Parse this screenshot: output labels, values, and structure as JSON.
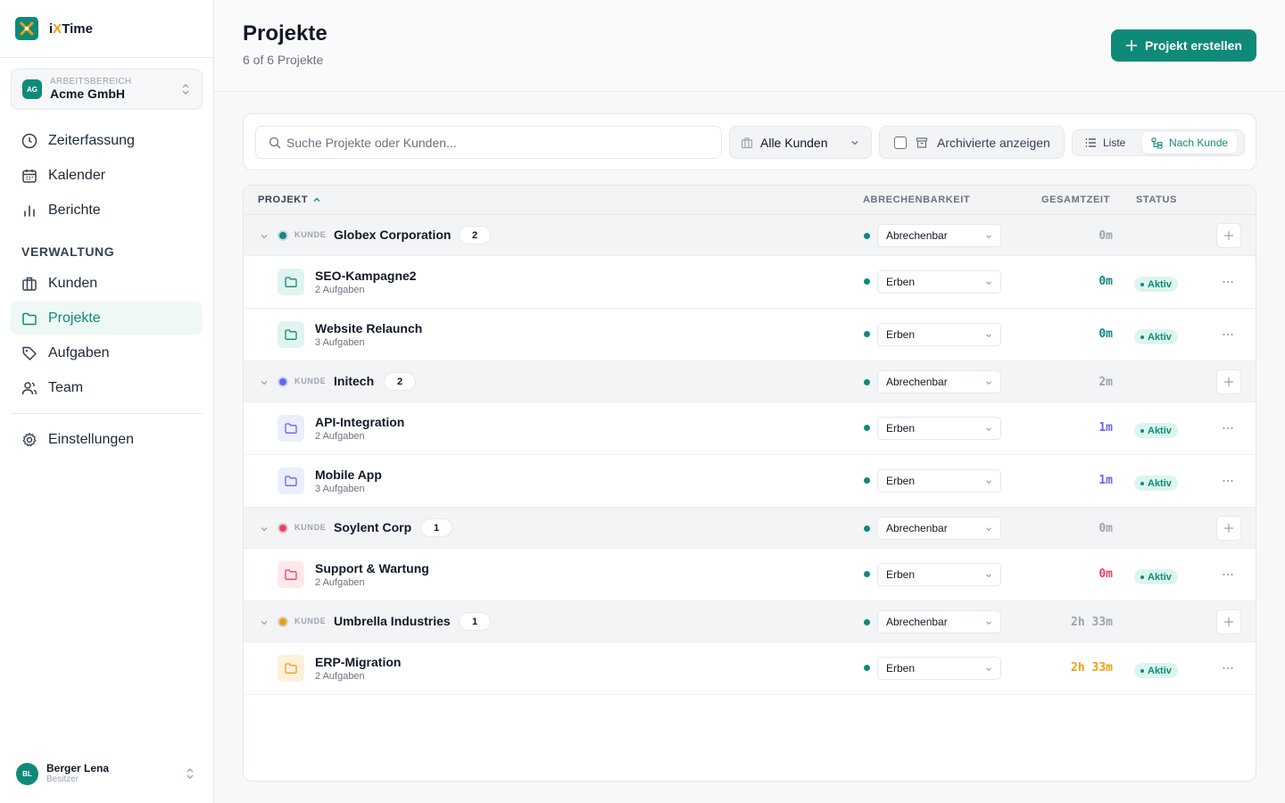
{
  "app": {
    "name_prefix": "i",
    "name_x": "X",
    "name_suffix": "Time"
  },
  "workspace": {
    "label": "ARBEITSBEREICH",
    "name": "Acme GmbH",
    "initials": "AG"
  },
  "nav": {
    "zeiterfassung": "Zeiterfassung",
    "kalender": "Kalender",
    "berichte": "Berichte",
    "section": "VERWALTUNG",
    "kunden": "Kunden",
    "projekte": "Projekte",
    "aufgaben": "Aufgaben",
    "team": "Team",
    "einstellungen": "Einstellungen"
  },
  "user": {
    "initials": "BL",
    "name": "Berger Lena",
    "role": "Besitzer"
  },
  "header": {
    "title": "Projekte",
    "subtitle": "6 of 6 Projekte",
    "create_label": "Projekt erstellen"
  },
  "toolbar": {
    "search_placeholder": "Suche Projekte oder Kunden...",
    "customer_filter": "Alle Kunden",
    "archive_label": "Archivierte anzeigen",
    "view_list": "Liste",
    "view_by_customer": "Nach Kunde"
  },
  "table": {
    "headers": {
      "project": "PROJEKT",
      "billing": "ABRECHENBARKEIT",
      "total": "GESAMTZEIT",
      "status": "STATUS"
    },
    "kunde_label": "KUNDE",
    "groups": [
      {
        "name": "Globex Corporation",
        "count": "2",
        "billing": "Abrechenbar",
        "time": "0m",
        "color": "#0f8a78",
        "projects": [
          {
            "name": "SEO-Kampagne2",
            "tasks": "2 Aufgaben",
            "billing": "Erben",
            "time": "0m",
            "status": "Aktiv"
          },
          {
            "name": "Website Relaunch",
            "tasks": "3 Aufgaben",
            "billing": "Erben",
            "time": "0m",
            "status": "Aktiv"
          }
        ]
      },
      {
        "name": "Initech",
        "count": "2",
        "billing": "Abrechenbar",
        "time": "2m",
        "color": "#6366f1",
        "projects": [
          {
            "name": "API-Integration",
            "tasks": "2 Aufgaben",
            "billing": "Erben",
            "time": "1m",
            "status": "Aktiv"
          },
          {
            "name": "Mobile App",
            "tasks": "3 Aufgaben",
            "billing": "Erben",
            "time": "1m",
            "status": "Aktiv"
          }
        ]
      },
      {
        "name": "Soylent Corp",
        "count": "1",
        "billing": "Abrechenbar",
        "time": "0m",
        "color": "#f43f5e",
        "projects": [
          {
            "name": "Support & Wartung",
            "tasks": "2 Aufgaben",
            "billing": "Erben",
            "time": "0m",
            "status": "Aktiv"
          }
        ]
      },
      {
        "name": "Umbrella Industries",
        "count": "1",
        "billing": "Abrechenbar",
        "time": "2h 33m",
        "color": "#f59e0b",
        "projects": [
          {
            "name": "ERP-Migration",
            "tasks": "2 Aufgaben",
            "billing": "Erben",
            "time": "2h 33m",
            "status": "Aktiv"
          }
        ]
      }
    ]
  },
  "colors": {
    "accent": "#0f8a78",
    "accent_soft": "#dcf5ee"
  }
}
